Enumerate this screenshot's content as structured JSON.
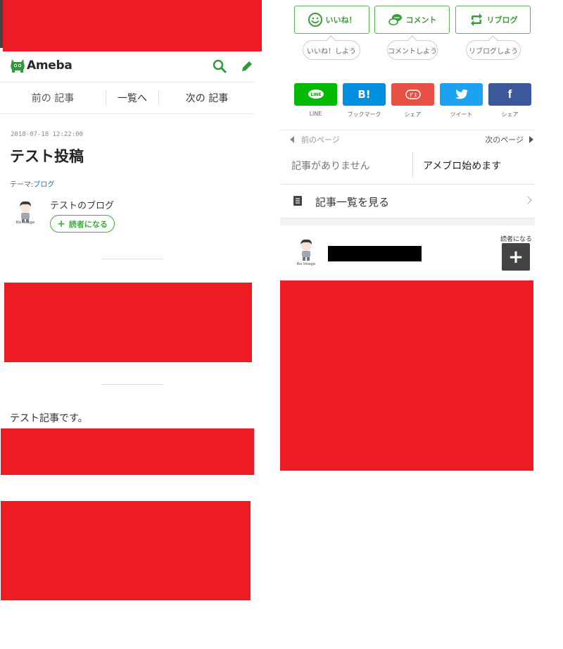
{
  "header": {
    "logo_text": "Ameba",
    "icons": [
      "search-icon",
      "pencil-icon"
    ],
    "accent_color": "#2f9a3c"
  },
  "article_nav": {
    "prev": "前の 記事",
    "list": "一覧へ",
    "next": "次の 記事"
  },
  "post": {
    "date": "2018-07-18 12:22:00",
    "title": "テスト投稿",
    "theme_label": "テーマ:",
    "theme_value": "ブログ",
    "body": "テスト記事です。"
  },
  "author": {
    "avatar_caption": "No image",
    "blog_name": "テストのブログ",
    "follow_label": "読者になる"
  },
  "actions": {
    "like": {
      "label": "いいね！",
      "bubble": "いいね！しよう"
    },
    "comment": {
      "label": "コメント",
      "bubble": "コメントしよう"
    },
    "reblog": {
      "label": "リブログ",
      "bubble": "リブログしよう"
    },
    "color": "#3a9e36"
  },
  "share": [
    {
      "name": "LINE",
      "glyph": "LINE",
      "caption": "LINE",
      "color": "#00b900"
    },
    {
      "name": "hatena",
      "glyph": "B!",
      "caption": "ブックマーク",
      "color": "#008fde"
    },
    {
      "name": "mixi",
      "glyph": "ﾃﾞｽ",
      "caption": "シェア",
      "color": "#e84f45"
    },
    {
      "name": "twitter",
      "glyph": "twitter",
      "caption": "ツイート",
      "color": "#1da1f2"
    },
    {
      "name": "facebook",
      "glyph": "f",
      "caption": "シェア",
      "color": "#3b5998"
    }
  ],
  "pager": {
    "prev_label": "前のページ",
    "next_label": "次のページ",
    "prev_title": "記事がありません",
    "next_title": "アメブロ始めます"
  },
  "entry_list": {
    "label": "記事一覧を見る"
  },
  "follow_card": {
    "avatar_caption": "No image",
    "follow_label": "読者になる",
    "follow_button": "+"
  }
}
